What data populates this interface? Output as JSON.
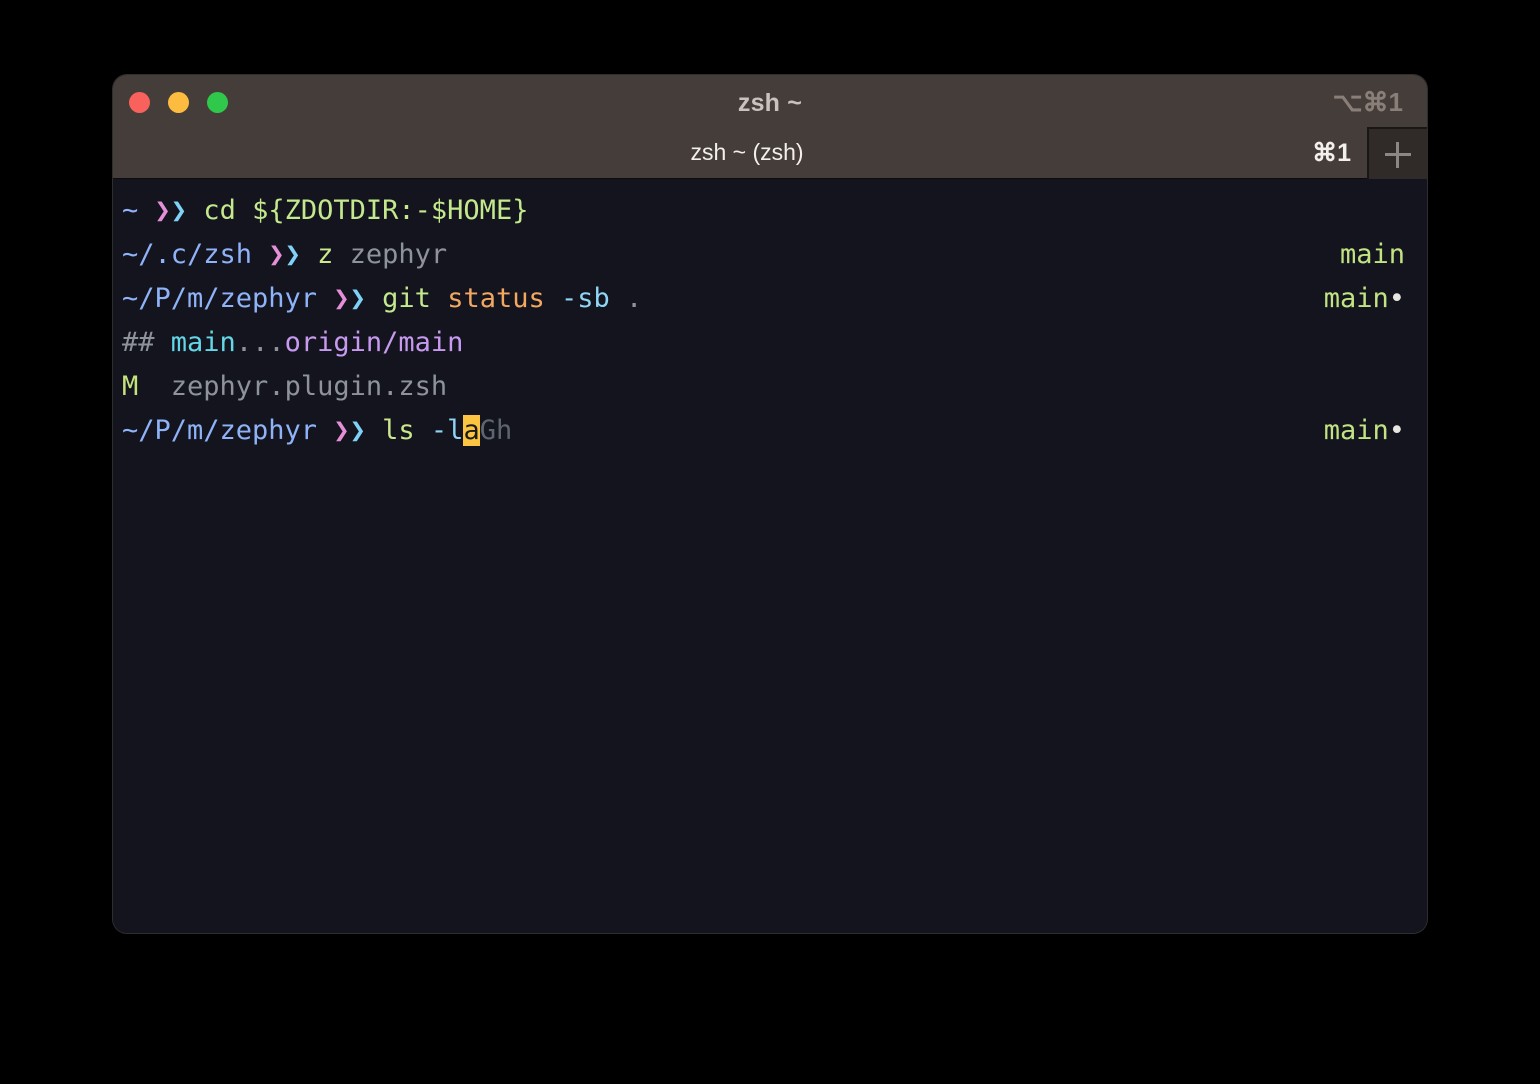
{
  "window": {
    "title": "zsh ~",
    "shortcut": "⌥⌘1",
    "traffic_lights": {
      "close": "close-button",
      "minimize": "minimize-button",
      "maximize": "maximize-button"
    }
  },
  "tab_bar": {
    "active_tab_title": "zsh ~ (zsh)",
    "tab_shortcut": "⌘1",
    "new_tab_label": "+"
  },
  "terminal": {
    "lines": [
      {
        "id": "line-1-cd",
        "prompt_path": "~",
        "prompt_arrow_left": "❯",
        "prompt_arrow_right": "❯",
        "command": "cd",
        "argument": "${ZDOTDIR:-$HOME}",
        "rprompt": ""
      },
      {
        "id": "line-2-z",
        "prompt_path": "~/.c/zsh",
        "prompt_arrow_left": "❯",
        "prompt_arrow_right": "❯",
        "command": "z",
        "argument": "zephyr",
        "rprompt": "main"
      },
      {
        "id": "line-3-git-status",
        "prompt_path": "~/P/m/zephyr",
        "prompt_arrow_left": "❯",
        "prompt_arrow_right": "❯",
        "command": "git",
        "subcommand": "status",
        "flag": "-sb",
        "argument": ".",
        "rprompt": "main",
        "rprompt_dirty": "•"
      },
      {
        "id": "line-4-branch-output",
        "marker": "##",
        "branch": "main",
        "separator": "...",
        "remote": "origin/main"
      },
      {
        "id": "line-5-modified-file",
        "status": "M",
        "file": "zephyr.plugin.zsh"
      },
      {
        "id": "line-6-input",
        "prompt_path": "~/P/m/zephyr",
        "prompt_arrow_left": "❯",
        "prompt_arrow_right": "❯",
        "command": "ls",
        "flag_before_cursor": "-l",
        "cursor_char": "a",
        "autosuggestion": "Gh",
        "rprompt": "main",
        "rprompt_dirty": "•"
      }
    ]
  },
  "colors": {
    "titlebar_bg": "#453d39",
    "terminal_bg": "#13141d",
    "path_blue": "#8fb3f9",
    "arrow_pink": "#e58fd8",
    "arrow_blue": "#7fd1f7",
    "command_green": "#c3e88d",
    "arg_orange": "#f3a862",
    "arg_blue": "#8fd5f5",
    "gray": "#8e939b",
    "cyan": "#63d7e8",
    "purple": "#c79af0",
    "branch_green": "#c2e383",
    "cursor_yellow": "#fbc541",
    "suggestion_gray": "#5d6670",
    "traffic_red": "#f9615c",
    "traffic_yellow": "#fdbc40",
    "traffic_green": "#2fc84a"
  }
}
